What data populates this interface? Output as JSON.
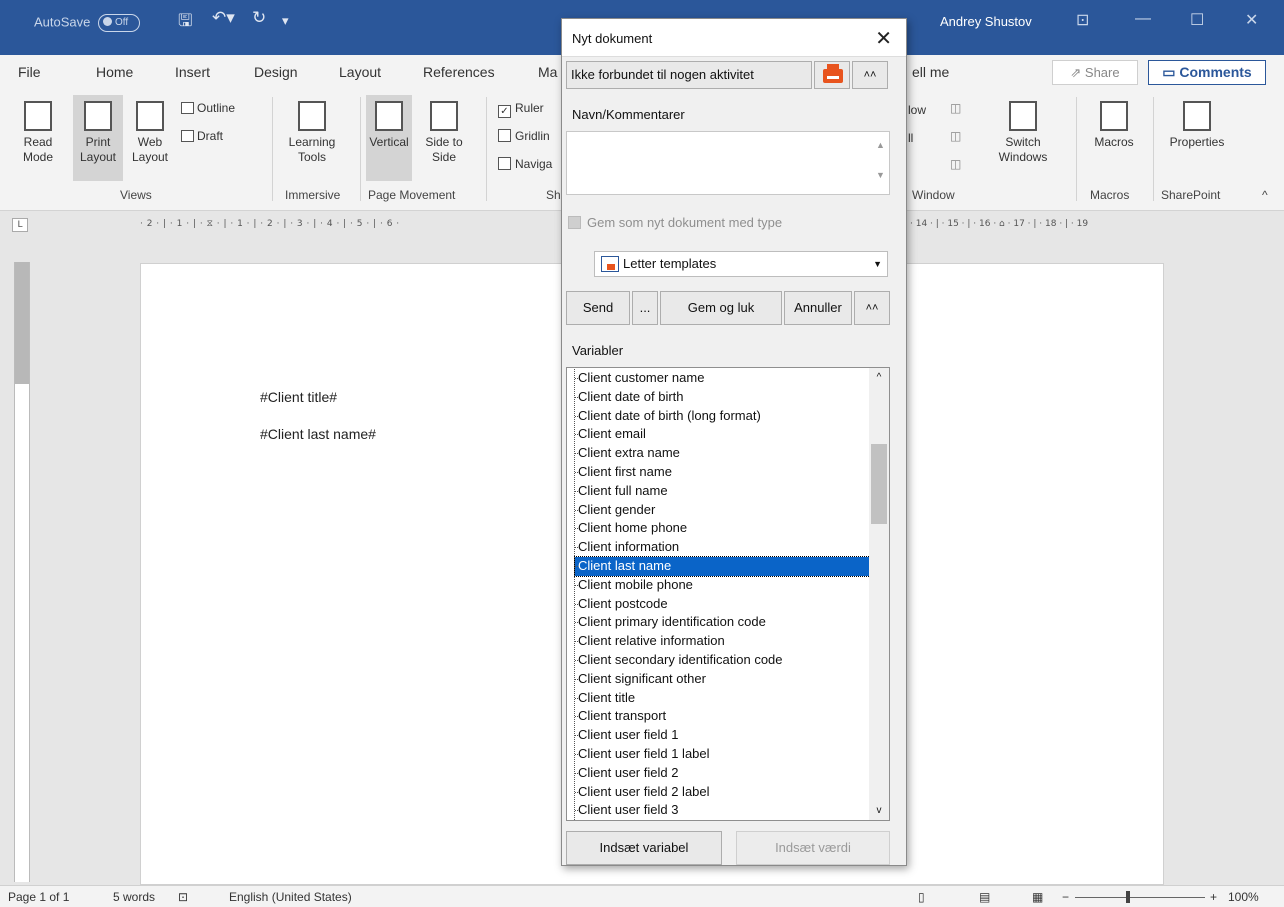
{
  "titlebar": {
    "autosave_label": "AutoSave",
    "autosave_state": "Off",
    "user_name": "Andrey Shustov"
  },
  "ribbon_tabs": [
    "File",
    "Home",
    "Insert",
    "Design",
    "Layout",
    "References",
    "Ma",
    "ell me"
  ],
  "ribbon_actions": {
    "share": "Share",
    "comments": "Comments"
  },
  "ribbon": {
    "views": {
      "read_mode": "Read Mode",
      "print_layout": "Print Layout",
      "web_layout": "Web Layout",
      "outline": "Outline",
      "draft": "Draft",
      "group": "Views"
    },
    "immersive": {
      "learning_tools": "Learning Tools",
      "group": "Immersive"
    },
    "page_movement": {
      "vertical": "Vertical",
      "side_to_side": "Side to Side",
      "group": "Page Movement"
    },
    "show": {
      "ruler": "Ruler",
      "gridlines": "Gridlin",
      "navigation": "Naviga",
      "group": "Sh"
    },
    "window": {
      "new_window": "low",
      "split": "ll",
      "switch_windows": "Switch Windows",
      "group": "Window"
    },
    "macros": {
      "label": "Macros",
      "group": "Macros"
    },
    "sharepoint": {
      "properties": "Properties",
      "group": "SharePoint"
    }
  },
  "ruler": {
    "left_ticks": "· 2 · | · 1 · | · ⧖ · | · 1 · | · 2 · | · 3 · | · 4 · | · 5 · | · 6 ·",
    "right_ticks": "· 14 · | · 15 · | · 16 · ⌂ · 17 · | · 18 · | · 19"
  },
  "document": {
    "line1": "#Client title#",
    "line2": "#Client last name#"
  },
  "statusbar": {
    "page": "Page 1 of 1",
    "words": "5 words",
    "language": "English (United States)",
    "zoom": "100%"
  },
  "dialog": {
    "title": "Nyt dokument",
    "activity": "Ikke forbundet til nogen aktivitet",
    "comments_label": "Navn/Kommentarer",
    "comments_value": "",
    "save_as_type": "Gem som nyt dokument med type",
    "template": "Letter templates",
    "buttons": {
      "send": "Send",
      "more": "...",
      "save_close": "Gem og luk",
      "cancel": "Annuller"
    },
    "variables_label": "Variabler",
    "variables": [
      "Client customer name",
      "Client date of birth",
      "Client date of birth (long format)",
      "Client email",
      "Client extra name",
      "Client first name",
      "Client full name",
      "Client gender",
      "Client home phone",
      "Client information",
      "Client last name",
      "Client mobile phone",
      "Client postcode",
      "Client primary identification code",
      "Client relative information",
      "Client secondary identification code",
      "Client significant other",
      "Client title",
      "Client transport",
      "Client user field 1",
      "Client user field 1 label",
      "Client user field 2",
      "Client user field 2 label",
      "Client user field 3"
    ],
    "selected_variable": "Client last name",
    "insert_variable": "Indsæt variabel",
    "insert_value": "Indsæt værdi"
  },
  "colors": {
    "word_blue": "#2b579a",
    "selection": "#0a64c8",
    "print_icon": "#e8541e"
  }
}
